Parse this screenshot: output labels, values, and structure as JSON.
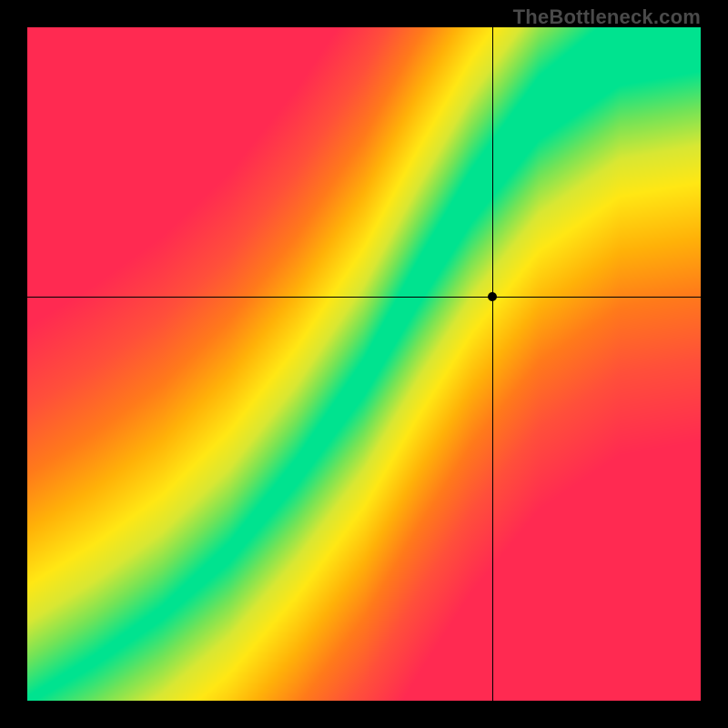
{
  "watermark": "TheBottleneck.com",
  "chart_data": {
    "type": "heatmap",
    "title": "",
    "xlabel": "",
    "ylabel": "",
    "xlim": [
      0,
      1
    ],
    "ylim": [
      0,
      1
    ],
    "grid": false,
    "legend": false,
    "marker": {
      "x": 0.69,
      "y": 0.6
    },
    "crosshair": {
      "x": 0.69,
      "y": 0.6
    },
    "ridge": {
      "description": "Optimal-balance ridge (green band) running from bottom-left to top-right with an S-curve; values fall off to yellow then orange then red with distance from ridge.",
      "control_points": [
        {
          "x": 0.0,
          "y": 0.0
        },
        {
          "x": 0.1,
          "y": 0.06
        },
        {
          "x": 0.2,
          "y": 0.13
        },
        {
          "x": 0.3,
          "y": 0.22
        },
        {
          "x": 0.4,
          "y": 0.34
        },
        {
          "x": 0.5,
          "y": 0.48
        },
        {
          "x": 0.58,
          "y": 0.62
        },
        {
          "x": 0.66,
          "y": 0.75
        },
        {
          "x": 0.76,
          "y": 0.88
        },
        {
          "x": 0.88,
          "y": 0.97
        },
        {
          "x": 1.0,
          "y": 1.0
        }
      ],
      "ridge_half_width": [
        {
          "x": 0.0,
          "w": 0.006
        },
        {
          "x": 0.2,
          "w": 0.01
        },
        {
          "x": 0.4,
          "w": 0.02
        },
        {
          "x": 0.6,
          "w": 0.035
        },
        {
          "x": 0.8,
          "w": 0.05
        },
        {
          "x": 1.0,
          "w": 0.065
        }
      ]
    },
    "color_stops": [
      {
        "t": 0.0,
        "color": "#00e38f"
      },
      {
        "t": 0.1,
        "color": "#72e357"
      },
      {
        "t": 0.2,
        "color": "#d8e733"
      },
      {
        "t": 0.3,
        "color": "#ffe714"
      },
      {
        "t": 0.45,
        "color": "#ffb108"
      },
      {
        "t": 0.6,
        "color": "#ff7a1a"
      },
      {
        "t": 0.78,
        "color": "#ff4f3a"
      },
      {
        "t": 1.0,
        "color": "#ff2a51"
      }
    ]
  }
}
